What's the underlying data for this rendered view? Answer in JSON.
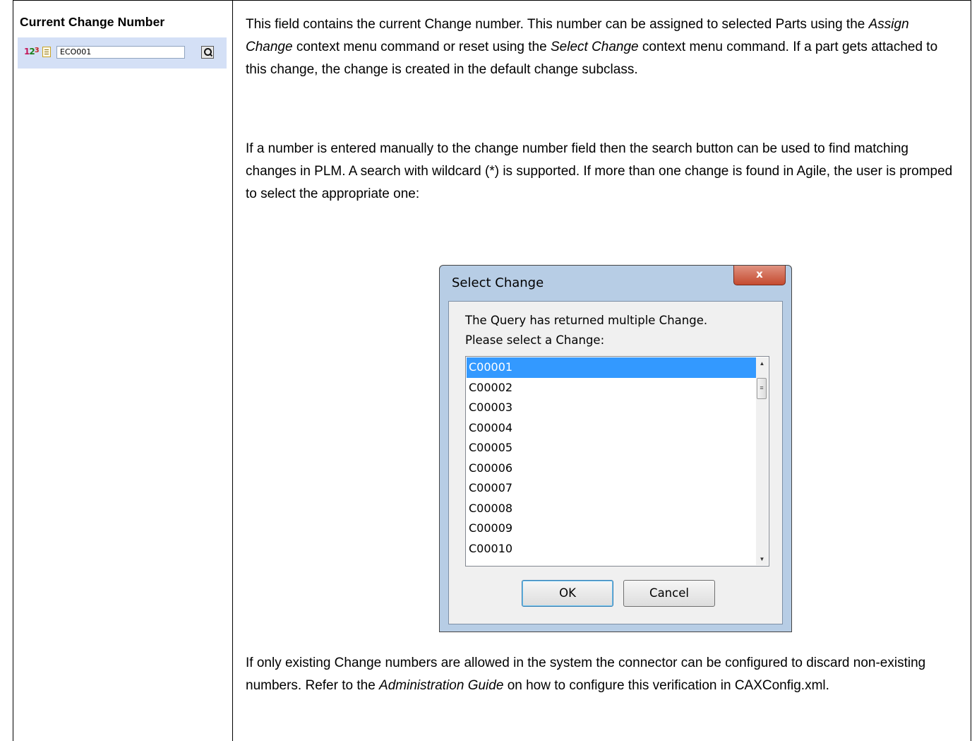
{
  "field": {
    "title": "Current Change Number",
    "toolbar_icon_1": "numbering-icon",
    "toolbar_icon_2": "document-icon",
    "input_value": "ECO001",
    "search_icon": "search-icon"
  },
  "description": {
    "p1_a": "This field contains the current Change number. This number can be assigned to selected Parts using the ",
    "p1_em1": "Assign Change",
    "p1_b": " context menu command or reset using the ",
    "p1_em2": "Select Change",
    "p1_c": " context menu command. If a part gets attached to this change, the change is created in the default change subclass.",
    "p2": "If a number is entered manually to the change number field then the search button can be used to find matching changes in PLM. A search with wildcard (*) is supported. If more than one change is found in Agile, the user is promped to select the appropriate one:",
    "p3_a": "If only existing Change numbers are allowed in the system the connector can be configured to discard non-existing numbers. Refer to the ",
    "p3_em": "Administration Guide",
    "p3_b": " on how to configure this verification in CAXConfig.xml."
  },
  "dialog": {
    "title": "Select Change",
    "close_label": "x",
    "message1": "The Query has returned multiple Change.",
    "message2": "Please select a Change:",
    "items": [
      "C00001",
      "C00002",
      "C00003",
      "C00004",
      "C00005",
      "C00006",
      "C00007",
      "C00008",
      "C00009",
      "C00010"
    ],
    "selected_index": 0,
    "ok_label": "OK",
    "cancel_label": "Cancel"
  }
}
